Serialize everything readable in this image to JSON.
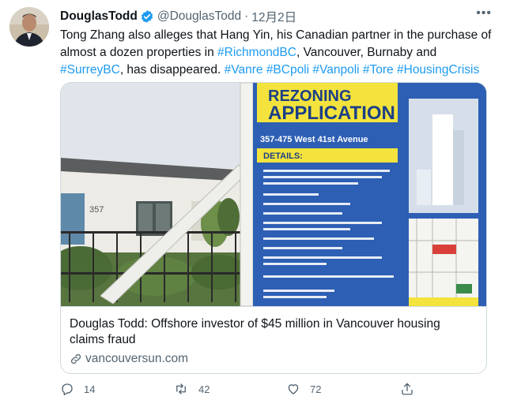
{
  "tweet": {
    "author_name": "DouglasTodd",
    "handle": "@DouglasTodd",
    "separator": "·",
    "date": "12月2日",
    "more": "•••",
    "text": {
      "p1": "Tong Zhang also alleges that Hang Yin, his Canadian partner in the purchase of almost a dozen properties in ",
      "h1": "#RichmondBC",
      "p2": ", Vancouver, Burnaby and ",
      "h2": "#SurreyBC",
      "p3": ", has disappeared. ",
      "h3": "#Vanre",
      "h4": "#BCpoli",
      "h5": "#Vanpoli",
      "h6": "#Tore",
      "h7": "#HousingCrisis"
    }
  },
  "card": {
    "title": "Douglas Todd: Offshore investor of $45 million in Vancouver housing claims fraud",
    "domain": "vancouversun.com",
    "image": {
      "sign_title_1": "REZONING",
      "sign_title_2": "APPLICATION",
      "address": "357-475 West 41st Avenue",
      "details_label": "DETAILS:",
      "house_number": "357"
    }
  },
  "actions": {
    "replies": "14",
    "retweets": "42",
    "likes": "72"
  },
  "colors": {
    "link": "#1d9bf0",
    "muted": "#536471",
    "sign_blue": "#2d5fb4",
    "sign_yellow": "#f3e33c"
  }
}
